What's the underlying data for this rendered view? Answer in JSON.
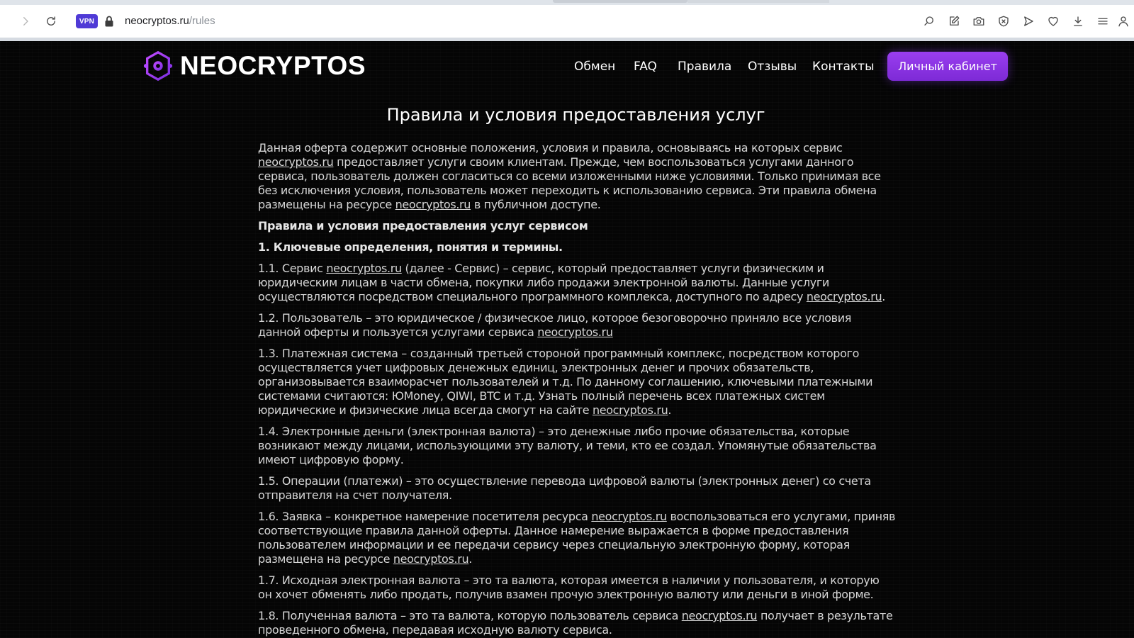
{
  "browser": {
    "vpn_label": "VPN",
    "url_host": "neocryptos.ru",
    "url_path": "/rules"
  },
  "site": {
    "logo_text": "NEOCRYPTOS",
    "nav": [
      "Обмен",
      "FAQ",
      "Правила",
      "Отзывы",
      "Контакты"
    ],
    "cabinet_button": "Личный кабинет",
    "page_title": "Правила и условия предоставления услуг",
    "link_text": "neocryptos.ru",
    "intro": {
      "t1": "Данная оферта содержит основные положения, условия и правила, основываясь на которых сервис ",
      "t2": " предоставляет услуги своим клиентам. Прежде, чем воспользоваться услугами данного сервиса, пользователь должен согласиться со всеми изложенными ниже условиями. Только принимая все без исключения условия, пользователь может переходить к использованию сервиса. Эти правила обмена размещены на ресурсе ",
      "t3": " в публичном доступе."
    },
    "heading1": "Правила и условия предоставления услуг сервисом",
    "heading2": "1. Ключевые определения, понятия и термины.",
    "p1_1": {
      "t1": "1.1. Сервис ",
      "t2": " (далее - Сервис) – сервис, который предоставляет услуги физическим и юридическим лицам в части обмена, покупки либо продажи электронной валюты. Данные услуги осуществляются посредством специального программного комплекса, доступного по адресу ",
      "t3": "."
    },
    "p1_2": {
      "t1": "1.2. Пользователь – это юридическое / физическое лицо, которое безоговорочно приняло все условия данной оферты и пользуется услугами сервиса "
    },
    "p1_3": {
      "t1": "1.3. Платежная система – созданный третьей стороной программный комплекс, посредством которого осуществляется учет цифровых денежных единиц, электронных денег и прочих обязательств, организовывается взаиморасчет пользователей и т.д. По данному соглашению, ключевыми платежными системами считаются: ЮMoney, QIWI, BTC и т.д. Узнать полный перечень всех платежных систем юридические и физические лица всегда смогут на сайте ",
      "t2": "."
    },
    "p1_4": "1.4. Электронные деньги (электронная валюта) – это денежные либо прочие обязательства, которые возникают между лицами, использующими эту валюту, и теми, кто ее создал. Упомянутые обязательства имеют цифровую форму.",
    "p1_5": "1.5. Операции (платежи) – это осуществление перевода цифровой валюты (электронных денег) со счета отправителя на счет получателя.",
    "p1_6": {
      "t1": "1.6. Заявка – конкретное намерение посетителя ресурса ",
      "t2": " воспользоваться его услугами, приняв соответствующие правила данной оферты. Данное намерение выражается в форме предоставления пользователем информации и ее передачи сервису через специальную электронную форму, которая размещена на ресурсе ",
      "t3": "."
    },
    "p1_7": "1.7. Исходная электронная валюта – это та валюта, которая имеется в наличии у пользователя, и которую он хочет обменять либо продать, получив взамен прочую электронную валюту или деньги в иной форме.",
    "p1_8": {
      "t1": "1.8. Полученная валюта – это та валюта, которую пользователь сервиса ",
      "t2": " получает в результате проведенного обмена, передавая исходную валюту сервиса."
    }
  }
}
